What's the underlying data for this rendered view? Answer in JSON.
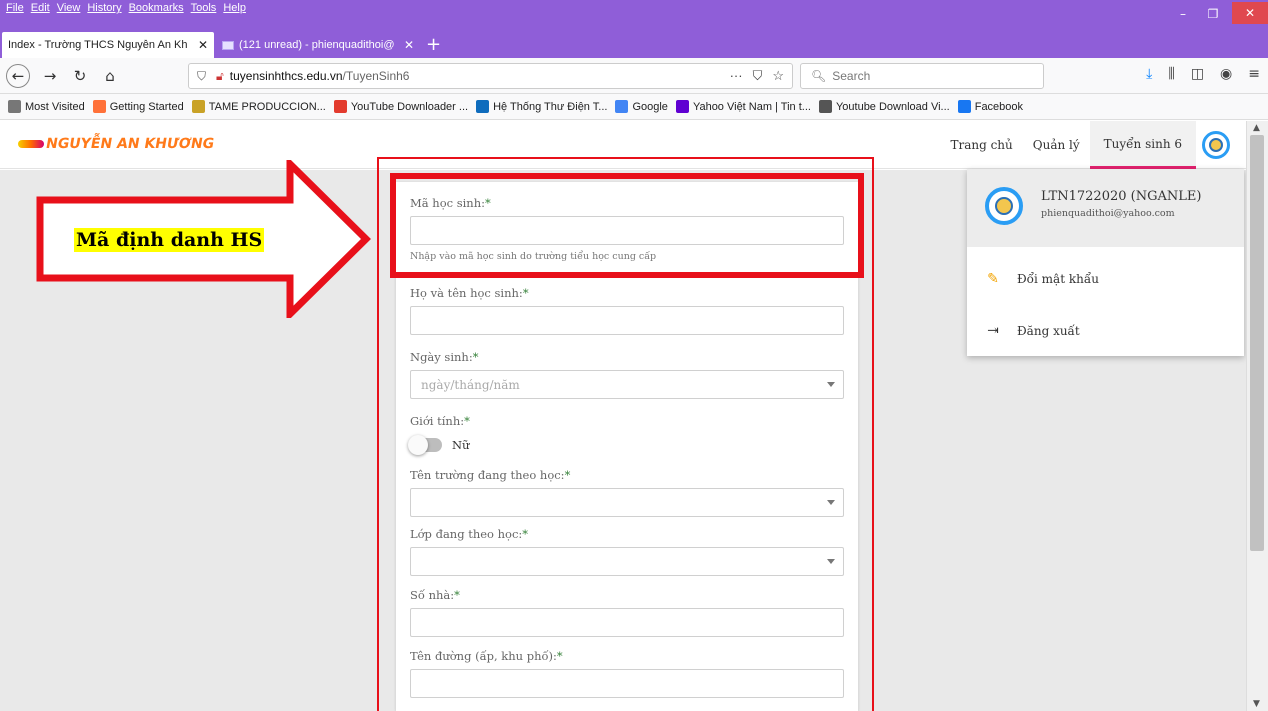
{
  "browser": {
    "menu": [
      "File",
      "Edit",
      "View",
      "History",
      "Bookmarks",
      "Tools",
      "Help"
    ],
    "tabs": [
      {
        "label": "Index - Trường THCS Nguyễn An Kh",
        "active": true
      },
      {
        "label": "(121 unread) - phienquadithoi@",
        "active": false
      }
    ],
    "url_host": "tuyensinhthcs.edu.vn",
    "url_path": "/TuyenSinh6",
    "search_placeholder": "Search",
    "bookmarks": [
      {
        "label": "Most Visited",
        "icon": "gear-icon",
        "color": "#777777"
      },
      {
        "label": "Getting Started",
        "icon": "firefox-icon",
        "color": "#ff7139"
      },
      {
        "label": "TAME PRODUCCION...",
        "icon": "tame-icon",
        "color": "#c9a227"
      },
      {
        "label": "YouTube Downloader ...",
        "icon": "download-icon",
        "color": "#e33b2e"
      },
      {
        "label": "Hệ Thống Thư Điện T...",
        "icon": "outlook-icon",
        "color": "#0f6cbd"
      },
      {
        "label": "Google",
        "icon": "google-icon",
        "color": "#4285f4"
      },
      {
        "label": "Yahoo Việt Nam | Tin t...",
        "icon": "yahoo-icon",
        "color": "#6001d2"
      },
      {
        "label": "Youtube Download Vi...",
        "icon": "globe-icon",
        "color": "#555555"
      },
      {
        "label": "Facebook",
        "icon": "facebook-icon",
        "color": "#1877f2"
      }
    ]
  },
  "site": {
    "logo_text": "NGUYỄN AN KHƯƠNG",
    "nav": [
      {
        "label": "Trang chủ",
        "active": false
      },
      {
        "label": "Quản lý",
        "active": false
      },
      {
        "label": "Tuyển sinh 6",
        "active": true
      }
    ]
  },
  "form": {
    "student_id": {
      "label": "Mã học sinh:",
      "required": "*",
      "value": "",
      "help": "Nhập vào mã học sinh do trường tiểu học cung cấp"
    },
    "full_name": {
      "label": "Họ và tên học sinh:",
      "required": "*",
      "value": ""
    },
    "dob": {
      "label": "Ngày sinh:",
      "required": "*",
      "placeholder": "ngày/tháng/năm"
    },
    "gender": {
      "label": "Giới tính:",
      "required": "*",
      "toggle_label": "Nữ"
    },
    "school": {
      "label": "Tên trường đang theo học:",
      "required": "*",
      "value": ""
    },
    "class": {
      "label": "Lớp đang theo học:",
      "required": "*",
      "value": ""
    },
    "house_no": {
      "label": "Số nhà:",
      "required": "*",
      "value": ""
    },
    "street": {
      "label": "Tên đường (ấp, khu phố):",
      "required": "*",
      "value": ""
    }
  },
  "user_menu": {
    "username": "LTN1722020 (NGANLE)",
    "email": "phienquadithoi@yahoo.com",
    "items": [
      {
        "label": "Đổi mật khẩu",
        "icon": "key-icon"
      },
      {
        "label": "Đăng xuất",
        "icon": "logout-icon"
      }
    ]
  },
  "annotation": {
    "label": "Mã định danh HS",
    "color": "#e8101a",
    "highlight": "#ffff00"
  }
}
